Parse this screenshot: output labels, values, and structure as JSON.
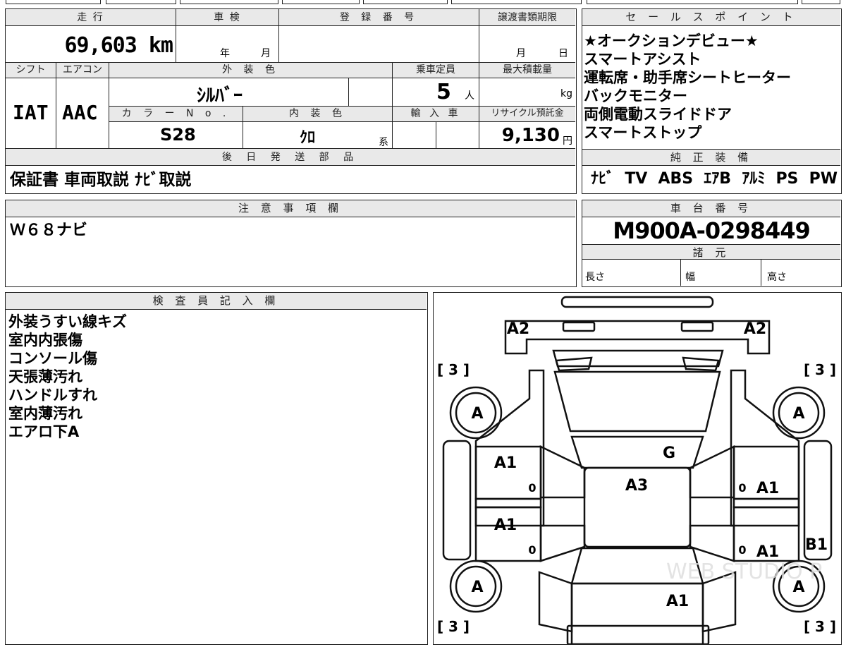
{
  "main_table": {
    "mileage_label": "走 行",
    "mileage_value": "69,603 km",
    "inspection_label": "車 検",
    "inspection_year": "年",
    "inspection_month": "月",
    "registration_label": "登 録 番 号",
    "transfer_deadline_label": "譲渡書類期限",
    "transfer_month": "月",
    "transfer_day": "日",
    "shift_label": "シフト",
    "shift_value": "IAT",
    "aircon_label": "エアコン",
    "aircon_value": "AAC",
    "exterior_color_label": "外 装 色",
    "exterior_color_value": "ｼﾙﾊﾞｰ",
    "capacity_label": "乗車定員",
    "capacity_value": "5",
    "capacity_unit": "人",
    "max_load_label": "最大積載量",
    "max_load_unit": "kg",
    "color_no_label": "カ ラ ー N o .",
    "color_no_value": "S28",
    "interior_color_label": "内 装 色",
    "interior_color_value": "ｸﾛ",
    "interior_color_suffix": "系",
    "import_label": "輸 入 車",
    "recycle_label": "リサイクル預託金",
    "recycle_value": "9,130",
    "recycle_unit": "円",
    "later_parts_label": "後 日 発 送 部 品",
    "later_parts_value": "保証書 車両取説 ﾅﾋﾞ取説"
  },
  "sales_points": {
    "label": "セ ー ル ス ポ イ ン ト",
    "items": [
      "★オークションデビュー★",
      "スマートアシスト",
      "運転席・助手席シートヒーター",
      "バックモニター",
      "両側電動スライドドア",
      "スマートストップ"
    ]
  },
  "equipment": {
    "label": "純 正 装 備",
    "items": [
      "ﾅﾋﾞ",
      "TV",
      "ABS",
      "ｴｱB",
      "ｱﾙﾐ",
      "PS",
      "PW"
    ]
  },
  "notes": {
    "label": "注 意 事 項 欄",
    "value": "Ｗ６８ナビ"
  },
  "chassis": {
    "label": "車 台 番 号",
    "value": "M900A-0298449",
    "spec_label": "諸 元",
    "length_label": "長さ",
    "width_label": "幅",
    "height_label": "高さ"
  },
  "inspector": {
    "label": "検 査 員 記 入 欄",
    "items": [
      "外装うすい線キズ",
      "室内内張傷",
      "コンソール傷",
      "天張薄汚れ",
      "ハンドルすれ",
      "室内薄汚れ",
      "エアロ下A"
    ]
  },
  "diagram": {
    "bracket_3": "[ 3 ]",
    "marks": {
      "front_left_corner": "A2",
      "front_right_corner": "A2",
      "front_left_wheel": "A",
      "front_right_wheel": "A",
      "rear_left_wheel": "A",
      "rear_right_wheel": "A",
      "windshield": "G",
      "roof": "A3",
      "left_front_door": "A1",
      "left_rear_door": "A1",
      "right_front_door": "A1",
      "right_rear_door": "A1",
      "right_rear_fender": "B1",
      "rear_hatch": "A1"
    },
    "zero": "0",
    "watermark": "WEB STUDIO P"
  }
}
